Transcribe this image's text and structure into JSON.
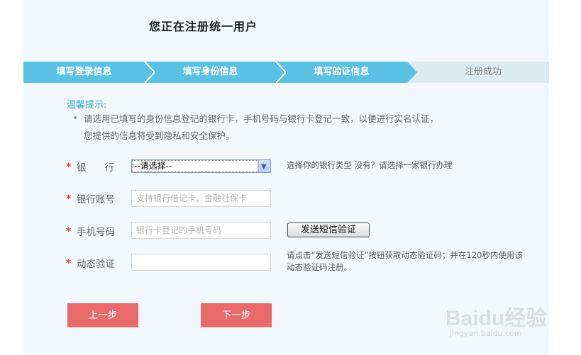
{
  "page": {
    "title": "您正在注册统一用户"
  },
  "steps": [
    {
      "label": "填写登录信息",
      "state": "done"
    },
    {
      "label": "填写身份信息",
      "state": "done"
    },
    {
      "label": "填写验证信息",
      "state": "current"
    },
    {
      "label": "注册成功",
      "state": "todo"
    }
  ],
  "tips": {
    "title": "温馨提示:",
    "line1": "请选用已填写的身份信息登记的银行卡，手机号码与银行卡登记一致，以便进行实名认证，",
    "line2": "您提供的信息将受到隐私和安全保护。"
  },
  "form": {
    "required_mark": "*",
    "bank": {
      "label": "银行",
      "selected": "--请选择--",
      "hint": "选择你的银行类型 没有？请选择一家银行办理"
    },
    "account": {
      "label": "银行账号",
      "placeholder": "支持银行借记卡、金融社保卡"
    },
    "phone": {
      "label": "手机号码",
      "placeholder": "银行卡登记的手机号码",
      "send_button": "发送短信验证"
    },
    "code": {
      "label": "动态验证",
      "value": "",
      "hint_line1": "请点击“发送短信验证”按钮获取动态验证码；并在120秒内使用该",
      "hint_line2": "动态验证码注册。"
    }
  },
  "buttons": {
    "prev": "上一步",
    "next": "下一步"
  },
  "watermark": {
    "text": "Baidu经验",
    "url": "jingyan.baidu.com"
  },
  "colors": {
    "step_active": "#5bc1e2",
    "step_inactive": "#dceaf1",
    "accent_text": "#3aa6cf",
    "required": "#e23c3c",
    "button": "#e86a6a"
  }
}
